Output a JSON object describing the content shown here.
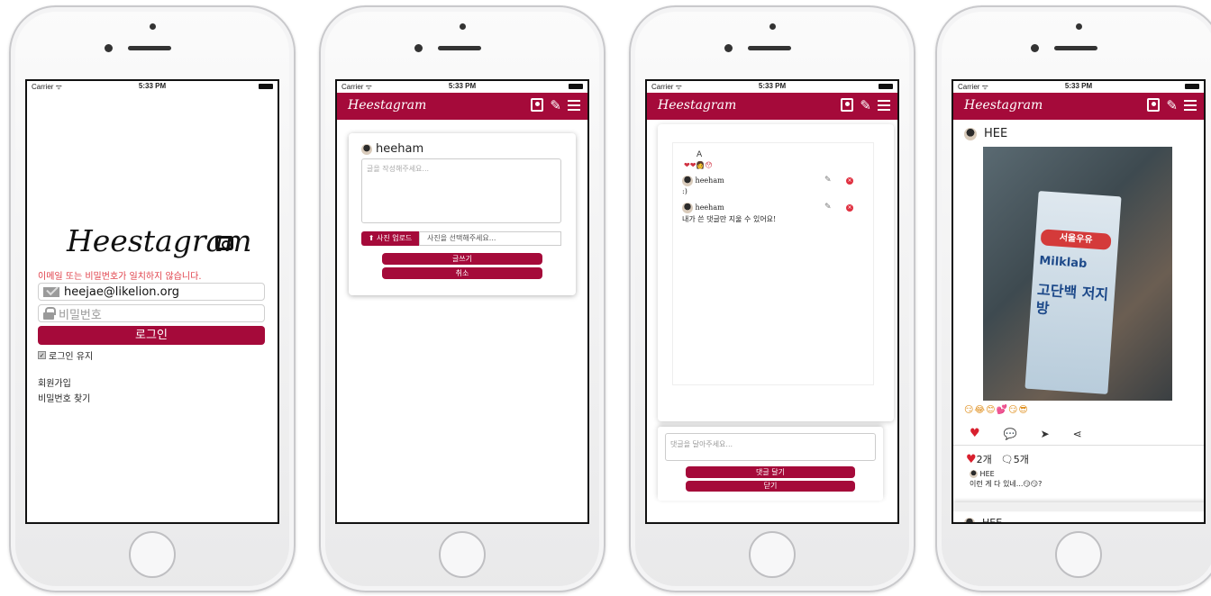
{
  "status": {
    "carrier": "Carrier ᯤ",
    "time": "5:33 PM"
  },
  "brand": "Heestagram",
  "login": {
    "error": "이메일 또는 비밀번호가 일치하지 않습니다.",
    "email_value": "heejae@likelion.org",
    "password_placeholder": "비밀번호",
    "login_button": "로그인",
    "keep_login": "로그인 유지",
    "signup": "회원가입",
    "find_password": "비밀번호 찾기"
  },
  "compose": {
    "username": "heeham",
    "text_placeholder": "글을 작성해주세요...",
    "upload_button": "사진 업로드",
    "file_placeholder": "사진을 선택해주세요...",
    "post_button": "글쓰기",
    "cancel_button": "취소"
  },
  "comments": {
    "post_title": "A",
    "post_emoji": "❤❤👩😯",
    "items": [
      {
        "user": "heeham",
        "text": ":)"
      },
      {
        "user": "heeham",
        "text": "내가 쓴 댓글만 지울 수 있어요!"
      }
    ],
    "input_placeholder": "댓글을 달아주세요...",
    "add_button": "댓글 달기",
    "close_button": "닫기"
  },
  "feed": {
    "username": "HEE",
    "image": {
      "brand": "서울우유",
      "label_top": "Milklab",
      "label_big": "고단백 저지방"
    },
    "emoji_line": "😏😂😊💕😏😎",
    "likes": "2개",
    "comment_count": "5개",
    "comment_user": "HEE",
    "comment_text": "이런 게 다 있네...😏😏?",
    "next_username": "HEE"
  }
}
